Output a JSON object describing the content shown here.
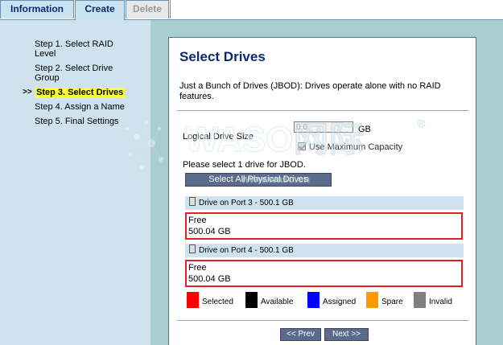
{
  "tabs": {
    "information": "Information",
    "create": "Create",
    "delete": "Delete"
  },
  "steps": {
    "active_marker": ">>",
    "items": [
      {
        "label": "Step 1. Select RAID Level"
      },
      {
        "label": "Step 2. Select Drive Group"
      },
      {
        "label": "Step 3. Select Drives"
      },
      {
        "label": "Step 4. Assign a Name"
      },
      {
        "label": "Step 5. Final Settings"
      }
    ],
    "active_index": 2
  },
  "main": {
    "title": "Select Drives",
    "description": "Just a Bunch of Drives (JBOD): Drives operate alone with no RAID features.",
    "logical_size_label": "Logical Drive Size",
    "logical_size_value": "0.0",
    "logical_size_unit": "GB",
    "use_max_label": "Use Maximum Capacity",
    "use_max_checked": true,
    "select_prompt": "Please select 1 drive for JBOD.",
    "select_all_button": "Select All Physical Drives",
    "drives": [
      {
        "header": "Drive on Port 3 - 500.1 GB",
        "status": "Free",
        "size": "500.04 GB"
      },
      {
        "header": "Drive on Port 4 - 500.1 GB",
        "status": "Free",
        "size": "500.04 GB"
      }
    ],
    "legend": [
      {
        "label": "Selected",
        "color": "#ff0000"
      },
      {
        "label": "Available",
        "color": "#000000"
      },
      {
        "label": "Assigned",
        "color": "#0000ff"
      },
      {
        "label": "Spare",
        "color": "#ff9900"
      },
      {
        "label": "Invalid",
        "color": "#808080"
      }
    ],
    "prev_button": "<< Prev",
    "next_button": "Next >>"
  },
  "watermark": {
    "brand": "WASO网际",
    "url": "www.waso.cn",
    "mark": "®"
  }
}
